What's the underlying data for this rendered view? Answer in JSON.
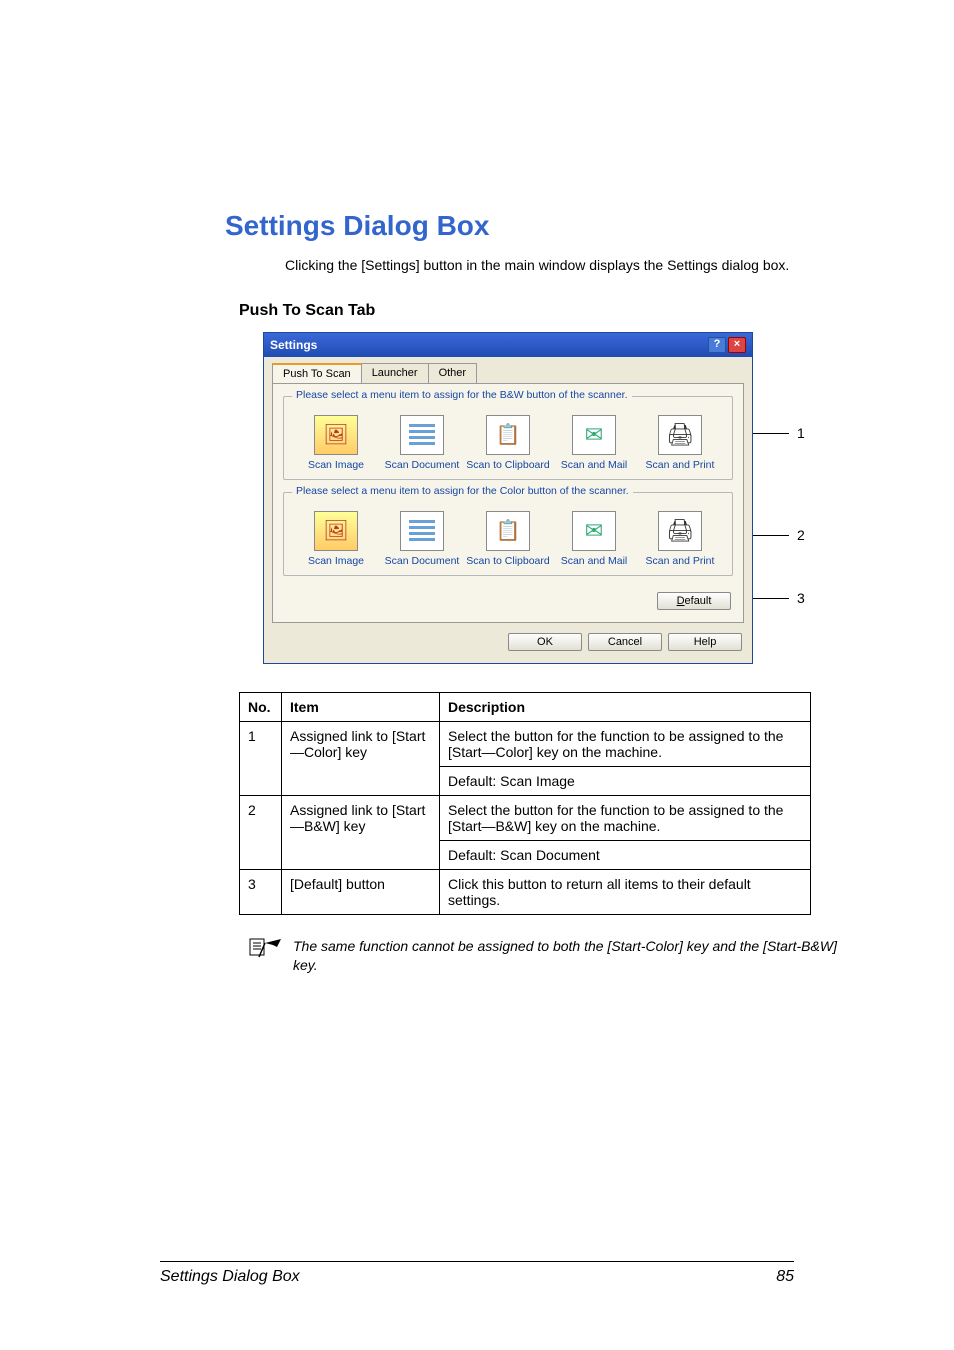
{
  "heading": "Settings Dialog Box",
  "intro": "Clicking the [Settings] button in the main window displays the Settings dialog box.",
  "subheading": "Push To Scan Tab",
  "dialog": {
    "title": "Settings",
    "tabs": {
      "t1": "Push To Scan",
      "t2": "Launcher",
      "t3": "Other"
    },
    "group_bw_legend": "Please select a menu item to assign for the B&W button of the scanner.",
    "group_color_legend": "Please select a menu item to assign for the Color button of the scanner.",
    "icons": {
      "c1": "Scan Image",
      "c2": "Scan Document",
      "c3": "Scan to Clipboard",
      "c4": "Scan and Mail",
      "c5": "Scan and Print"
    },
    "default_btn": "Default",
    "ok_btn": "OK",
    "cancel_btn": "Cancel",
    "help_btn": "Help"
  },
  "callouts": {
    "n1": "1",
    "n2": "2",
    "n3": "3"
  },
  "table": {
    "head": {
      "no": "No.",
      "item": "Item",
      "desc": "Description"
    },
    "rows": [
      {
        "no": "1",
        "item": "Assigned link to [Start—Color] key",
        "desc": "Select the button for the function to be assigned to the [Start—Color] key on the machine.",
        "default": "Default: Scan Image"
      },
      {
        "no": "2",
        "item": "Assigned link to [Start—B&W] key",
        "desc": "Select the button for the function to be assigned to the [Start—B&W] key on the machine.",
        "default": "Default: Scan Document"
      },
      {
        "no": "3",
        "item": "[Default] button",
        "desc": "Click this button to return all items to their default settings.",
        "default": ""
      }
    ]
  },
  "note": "The same function cannot be assigned to both the [Start-Color] key and the [Start-B&W] key.",
  "footer": {
    "title": "Settings Dialog Box",
    "page": "85"
  }
}
